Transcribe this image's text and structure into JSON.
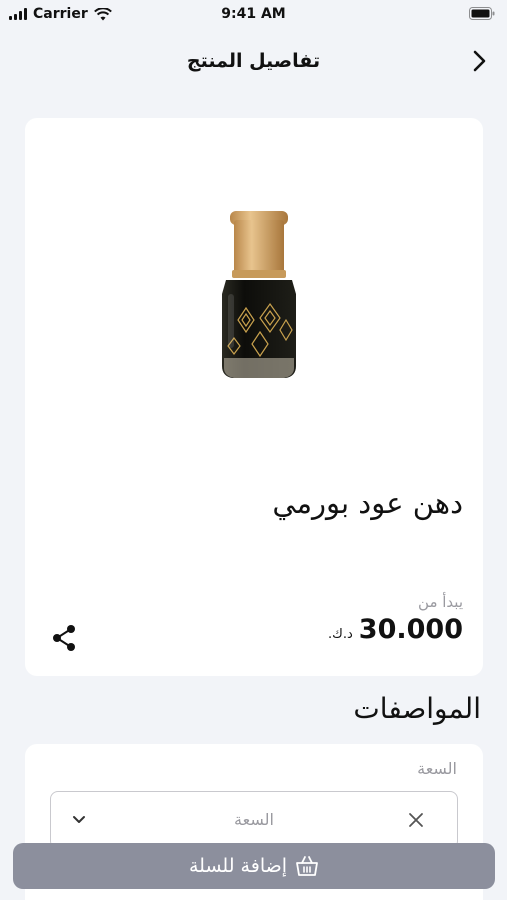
{
  "status_bar": {
    "carrier": "Carrier",
    "time": "9:41 AM"
  },
  "nav": {
    "title": "تفاصيل المنتج"
  },
  "product": {
    "name": "دهن عود بورمي",
    "price_prefix": "يبدأ من",
    "price": "30.000",
    "currency": "د.ك."
  },
  "specs": {
    "title": "المواصفات",
    "capacity_label": "السعة",
    "capacity_placeholder": "السعة"
  },
  "cart": {
    "button_label": "إضافة للسلة"
  },
  "colors": {
    "background": "#f2f4f8",
    "button": "#8c8f9d",
    "muted_text": "#9a9aa0"
  }
}
